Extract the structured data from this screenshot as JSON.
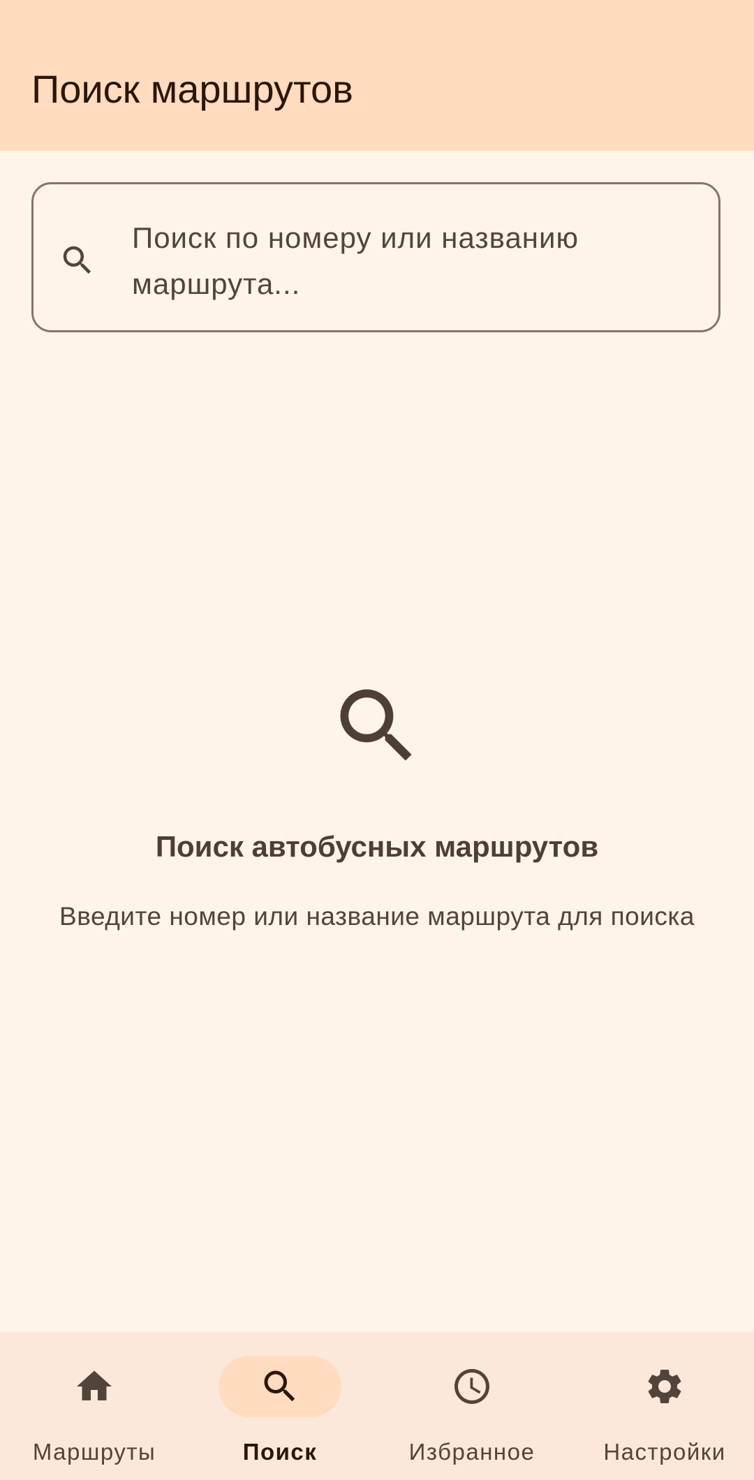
{
  "app_bar": {
    "title": "Поиск маршрутов"
  },
  "search": {
    "placeholder": "Поиск по номеру или названию маршрута...",
    "value": "",
    "icon": "search-icon"
  },
  "empty_state": {
    "icon": "search-icon",
    "title": "Поиск автобусных маршрутов",
    "subtitle": "Введите номер или название маршрута для поиска"
  },
  "bottom_nav": {
    "items": [
      {
        "label": "Маршруты",
        "icon": "home-icon",
        "active": false
      },
      {
        "label": "Поиск",
        "icon": "search-icon",
        "active": true
      },
      {
        "label": "Избранное",
        "icon": "clock-icon",
        "active": false
      },
      {
        "label": "Настройки",
        "icon": "gear-icon",
        "active": false
      }
    ]
  },
  "colors": {
    "background": "#FFF4EA",
    "app_bar": "#FFDBC0",
    "bottom_nav": "#FCE8DB",
    "active_indicator": "#FFDBC0",
    "text_primary": "#2B1608",
    "text_secondary": "#52443A",
    "outline": "#857468"
  }
}
